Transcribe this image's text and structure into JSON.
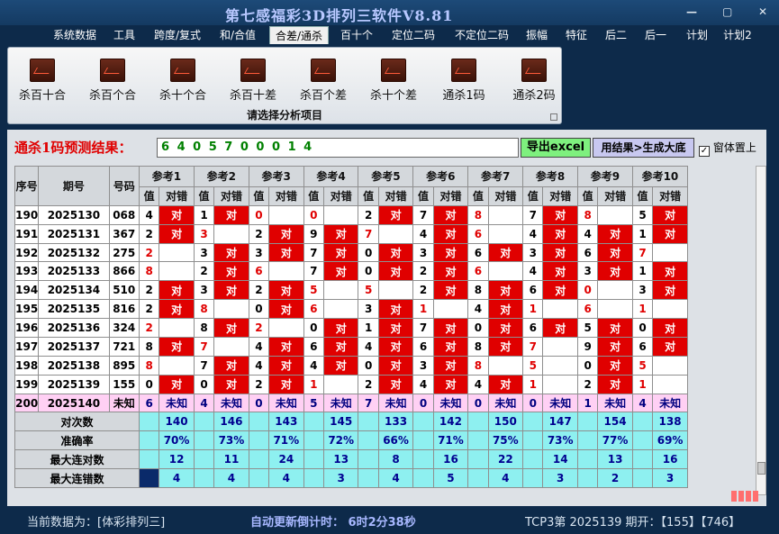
{
  "window": {
    "title": "第七感福彩3D排列三软件V8.81",
    "min": "—",
    "max": "▢",
    "close": "✕"
  },
  "menu": [
    "系统数据",
    "工具",
    "跨度/复式",
    "和/合值",
    "合差/通杀",
    "百十个",
    "定位二码",
    "不定位二码",
    "振幅",
    "特征",
    "后二",
    "后一",
    "计划",
    "计划2"
  ],
  "menu_active": "合差/通杀",
  "ribbon": {
    "buttons": [
      "杀百十合",
      "杀百个合",
      "杀十个合",
      "杀百十差",
      "杀百个差",
      "杀十个差",
      "通杀1码",
      "通杀2码"
    ],
    "caption": "请选择分析项目"
  },
  "prediction": {
    "label": "通杀1码预测结果：",
    "value": "6 4 0 5 7 0 0 0 1 4",
    "export_label": "导出excel",
    "gen_label": "用结果>生成大底",
    "ontop_label": "窗体置上",
    "ontop_checked": "✓"
  },
  "table": {
    "h_seq": "序号",
    "h_issue": "期号",
    "h_num": "号码",
    "refs": [
      "参考1",
      "参考2",
      "参考3",
      "参考4",
      "参考5",
      "参考6",
      "参考7",
      "参考8",
      "参考9",
      "参考10"
    ],
    "h_val": "值",
    "h_judge": "对错",
    "judge_mark": "对",
    "rows": [
      {
        "seq": "190",
        "issue": "2025130",
        "num": "068",
        "v": [
          "4",
          "1",
          "0",
          "0",
          "2",
          "7",
          "8",
          "7",
          "8",
          "5"
        ],
        "h": [
          1,
          1,
          0,
          0,
          1,
          1,
          0,
          1,
          0,
          1
        ],
        "r": [
          0,
          0,
          1,
          1,
          0,
          0,
          1,
          0,
          1,
          0
        ]
      },
      {
        "seq": "191",
        "issue": "2025131",
        "num": "367",
        "v": [
          "2",
          "3",
          "2",
          "9",
          "7",
          "4",
          "6",
          "4",
          "4",
          "1"
        ],
        "h": [
          1,
          0,
          1,
          1,
          0,
          1,
          0,
          1,
          1,
          1
        ],
        "r": [
          0,
          1,
          0,
          0,
          1,
          0,
          1,
          0,
          0,
          0
        ]
      },
      {
        "seq": "192",
        "issue": "2025132",
        "num": "275",
        "v": [
          "2",
          "3",
          "3",
          "7",
          "0",
          "3",
          "6",
          "3",
          "6",
          "7"
        ],
        "h": [
          0,
          1,
          1,
          1,
          1,
          1,
          1,
          1,
          1,
          0
        ],
        "r": [
          1,
          0,
          0,
          0,
          0,
          0,
          0,
          0,
          0,
          1
        ]
      },
      {
        "seq": "193",
        "issue": "2025133",
        "num": "866",
        "v": [
          "8",
          "2",
          "6",
          "7",
          "0",
          "2",
          "6",
          "4",
          "3",
          "1"
        ],
        "h": [
          0,
          1,
          0,
          1,
          1,
          1,
          0,
          1,
          1,
          1
        ],
        "r": [
          1,
          0,
          1,
          0,
          0,
          0,
          1,
          0,
          0,
          0
        ]
      },
      {
        "seq": "194",
        "issue": "2025134",
        "num": "510",
        "v": [
          "2",
          "3",
          "2",
          "5",
          "5",
          "2",
          "8",
          "6",
          "0",
          "3"
        ],
        "h": [
          1,
          1,
          1,
          0,
          0,
          1,
          1,
          1,
          0,
          1
        ],
        "r": [
          0,
          0,
          0,
          1,
          1,
          0,
          0,
          0,
          1,
          0
        ]
      },
      {
        "seq": "195",
        "issue": "2025135",
        "num": "816",
        "v": [
          "2",
          "8",
          "0",
          "6",
          "3",
          "1",
          "4",
          "1",
          "6",
          "1"
        ],
        "h": [
          1,
          0,
          1,
          0,
          1,
          0,
          1,
          0,
          0,
          0
        ],
        "r": [
          0,
          1,
          0,
          1,
          0,
          1,
          0,
          1,
          1,
          1
        ]
      },
      {
        "seq": "196",
        "issue": "2025136",
        "num": "324",
        "v": [
          "2",
          "8",
          "2",
          "0",
          "1",
          "7",
          "0",
          "6",
          "5",
          "0"
        ],
        "h": [
          0,
          1,
          0,
          1,
          1,
          1,
          1,
          1,
          1,
          1
        ],
        "r": [
          1,
          0,
          1,
          0,
          0,
          0,
          0,
          0,
          0,
          0
        ]
      },
      {
        "seq": "197",
        "issue": "2025137",
        "num": "721",
        "v": [
          "8",
          "7",
          "4",
          "6",
          "4",
          "6",
          "8",
          "7",
          "9",
          "6"
        ],
        "h": [
          1,
          0,
          1,
          1,
          1,
          1,
          1,
          0,
          1,
          1
        ],
        "r": [
          0,
          1,
          0,
          0,
          0,
          0,
          0,
          1,
          0,
          0
        ]
      },
      {
        "seq": "198",
        "issue": "2025138",
        "num": "895",
        "v": [
          "8",
          "7",
          "4",
          "4",
          "0",
          "3",
          "8",
          "5",
          "0",
          "5"
        ],
        "h": [
          0,
          1,
          1,
          1,
          1,
          1,
          0,
          0,
          1,
          0
        ],
        "r": [
          1,
          0,
          0,
          0,
          0,
          0,
          1,
          1,
          0,
          1
        ]
      },
      {
        "seq": "199",
        "issue": "2025139",
        "num": "155",
        "v": [
          "0",
          "0",
          "2",
          "1",
          "2",
          "4",
          "4",
          "1",
          "2",
          "1"
        ],
        "h": [
          1,
          1,
          1,
          0,
          1,
          1,
          1,
          0,
          1,
          0
        ],
        "r": [
          0,
          0,
          0,
          1,
          0,
          0,
          0,
          1,
          0,
          1
        ]
      }
    ],
    "pending": {
      "seq": "200",
      "issue": "2025140",
      "num": "未知",
      "v": [
        "6",
        "4",
        "0",
        "5",
        "7",
        "0",
        "0",
        "0",
        "1",
        "4"
      ],
      "judge": "未知"
    },
    "stats": [
      {
        "label": "对次数",
        "values": [
          "140",
          "146",
          "143",
          "145",
          "133",
          "142",
          "150",
          "147",
          "154",
          "138"
        ]
      },
      {
        "label": "准确率",
        "values": [
          "70%",
          "73%",
          "71%",
          "72%",
          "66%",
          "71%",
          "75%",
          "73%",
          "77%",
          "69%"
        ]
      },
      {
        "label": "最大连对数",
        "values": [
          "12",
          "11",
          "24",
          "13",
          "8",
          "16",
          "22",
          "14",
          "13",
          "16"
        ]
      },
      {
        "label": "最大连错数",
        "values": [
          "4",
          "4",
          "4",
          "3",
          "4",
          "5",
          "4",
          "3",
          "2",
          "3"
        ]
      }
    ]
  },
  "status": {
    "source": "当前数据为：[体彩排列三]",
    "timer": "自动更新倒计时： 6时2分38秒",
    "issue": "TCP3第 2025139 期开：【155】【746】"
  },
  "colors": {
    "hit": "#e00000",
    "stat_bg": "#8ef0f0",
    "pending_bg": "#ffd0f4",
    "title": "#b8c8ff"
  }
}
